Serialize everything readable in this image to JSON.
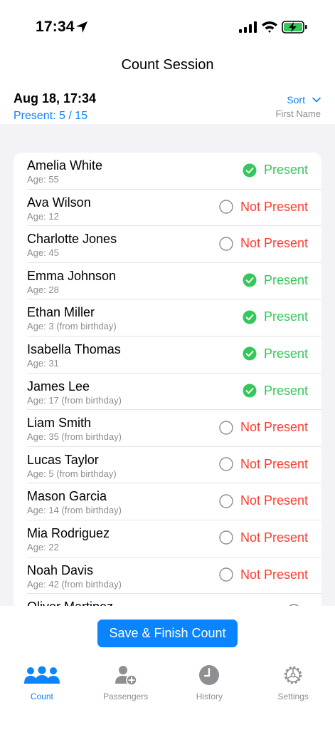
{
  "status_bar": {
    "time": "17:34"
  },
  "nav": {
    "title": "Count Session"
  },
  "header": {
    "date": "Aug 18, 17:34",
    "present_summary": "Present: 5 / 15",
    "sort_label": "Sort",
    "sort_value": "First Name"
  },
  "passengers": [
    {
      "name": "Amelia White",
      "age": "Age: 55",
      "status": "Present",
      "present": true
    },
    {
      "name": "Ava Wilson",
      "age": "Age: 12",
      "status": "Not Present",
      "present": false
    },
    {
      "name": "Charlotte Jones",
      "age": "Age: 45",
      "status": "Not Present",
      "present": false
    },
    {
      "name": "Emma Johnson",
      "age": "Age: 28",
      "status": "Present",
      "present": true
    },
    {
      "name": "Ethan Miller",
      "age": "Age: 3 (from birthday)",
      "status": "Present",
      "present": true
    },
    {
      "name": "Isabella Thomas",
      "age": "Age: 31",
      "status": "Present",
      "present": true
    },
    {
      "name": "James Lee",
      "age": "Age: 17 (from birthday)",
      "status": "Present",
      "present": true
    },
    {
      "name": "Liam Smith",
      "age": "Age: 35 (from birthday)",
      "status": "Not Present",
      "present": false
    },
    {
      "name": "Lucas Taylor",
      "age": "Age: 5 (from birthday)",
      "status": "Not Present",
      "present": false
    },
    {
      "name": "Mason Garcia",
      "age": "Age: 14 (from birthday)",
      "status": "Not Present",
      "present": false
    },
    {
      "name": "Mia Rodriguez",
      "age": "Age: 22",
      "status": "Not Present",
      "present": false
    },
    {
      "name": "Noah Davis",
      "age": "Age: 42 (from birthday)",
      "status": "Not Present",
      "present": false
    },
    {
      "name": "Oliver Martinez",
      "age": "",
      "status": "",
      "present": false
    }
  ],
  "save_button": {
    "label": "Save & Finish Count"
  },
  "tabs": [
    {
      "label": "Count",
      "icon": "people-icon",
      "active": true
    },
    {
      "label": "Passengers",
      "icon": "add-person-icon",
      "active": false
    },
    {
      "label": "History",
      "icon": "clock-icon",
      "active": false
    },
    {
      "label": "Settings",
      "icon": "gear-icon",
      "active": false
    }
  ],
  "colors": {
    "accent": "#0a84ff",
    "present": "#34c759",
    "absent": "#ff3b30",
    "secondary_text": "#8e8e93",
    "list_background": "#f2f2f7"
  }
}
